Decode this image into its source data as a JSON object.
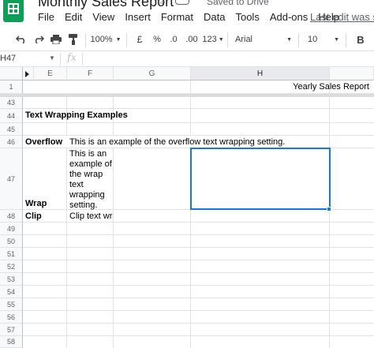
{
  "app": {
    "title": "Monthly Sales Report",
    "saved_status": "Saved to Drive",
    "last_edit": "Last edit was se",
    "brand_color": "#0f9d58"
  },
  "menu": [
    "File",
    "Edit",
    "View",
    "Insert",
    "Format",
    "Data",
    "Tools",
    "Add-ons",
    "Help"
  ],
  "toolbar": {
    "zoom": "100%",
    "currency": "£",
    "percent": "%",
    "decrease_decimals": ".0",
    "increase_decimals": ".00",
    "more_formats": "123",
    "font": "Arial",
    "font_size": "10"
  },
  "formula_bar": {
    "cell_ref": "H47",
    "fx": "fx",
    "value": ""
  },
  "columns": [
    "E",
    "F",
    "G",
    "H"
  ],
  "selected_column": "H",
  "rows": {
    "frozen": "1",
    "visible": [
      "43",
      "44",
      "45",
      "46",
      "47",
      "48",
      "49",
      "50",
      "51",
      "52",
      "53",
      "54",
      "55",
      "56",
      "57",
      "58"
    ]
  },
  "cells": {
    "H1": "Yearly Sales Report",
    "E44": "Text Wrapping Examples",
    "E46": "Overflow",
    "F46": "This is an example of the overflow text wrapping setting.",
    "E47": "Wrap",
    "F47": "This is an example of the wrap text wrapping setting.",
    "E48": "Clip",
    "F48": "Clip text wrapping"
  },
  "selection": {
    "cell": "H47",
    "color": "#1a73e8"
  }
}
